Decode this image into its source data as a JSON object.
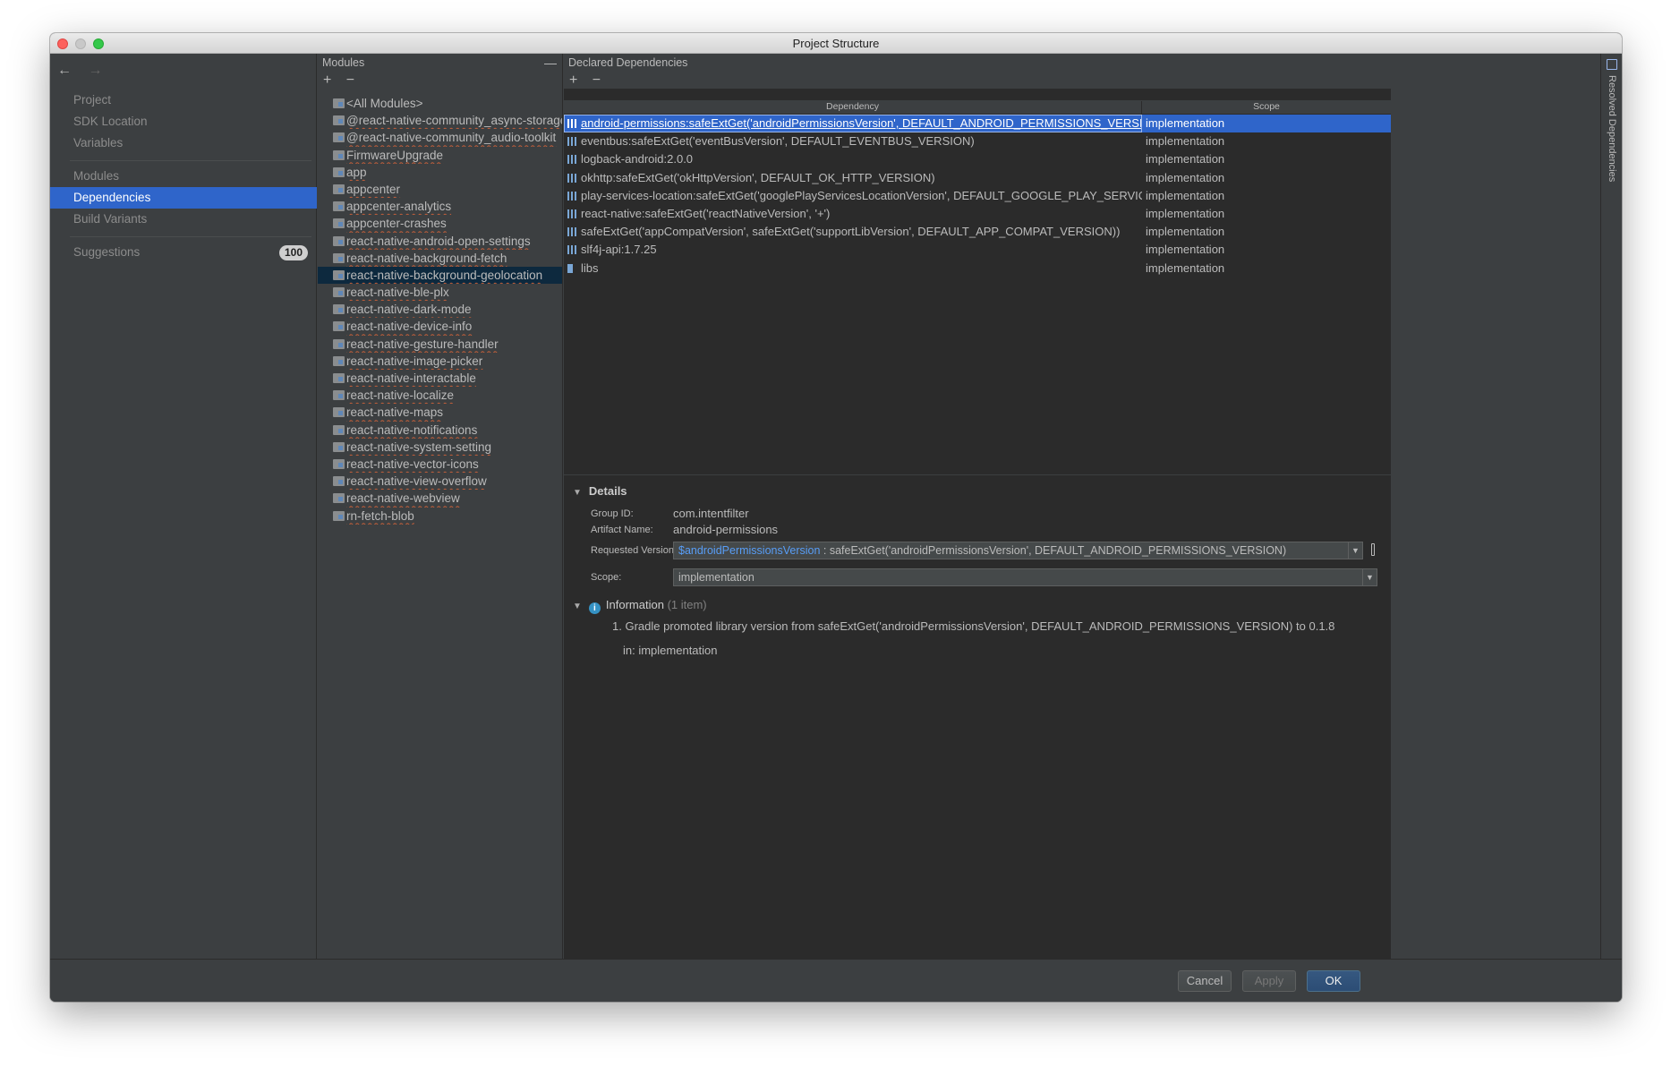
{
  "window": {
    "title": "Project Structure"
  },
  "nav": {
    "back_icon": "←",
    "forward_icon": "→",
    "items": [
      {
        "label": "Project"
      },
      {
        "label": "SDK Location"
      },
      {
        "label": "Variables"
      },
      {
        "label": "Modules"
      },
      {
        "label": "Dependencies",
        "selected": true
      },
      {
        "label": "Build Variants"
      },
      {
        "label": "Suggestions",
        "badge": "100"
      }
    ]
  },
  "modules": {
    "header": "Modules",
    "collapse_icon": "—",
    "add_icon": "+",
    "remove_icon": "−",
    "items": [
      "<All Modules>",
      "@react-native-community_async-storage",
      "@react-native-community_audio-toolkit",
      "FirmwareUpgrade",
      "app",
      "appcenter",
      "appcenter-analytics",
      "appcenter-crashes",
      "react-native-android-open-settings",
      "react-native-background-fetch",
      "react-native-background-geolocation",
      "react-native-ble-plx",
      "react-native-dark-mode",
      "react-native-device-info",
      "react-native-gesture-handler",
      "react-native-image-picker",
      "react-native-interactable",
      "react-native-localize",
      "react-native-maps",
      "react-native-notifications",
      "react-native-system-setting",
      "react-native-vector-icons",
      "react-native-view-overflow",
      "react-native-webview",
      "rn-fetch-blob"
    ],
    "selected_index": 10
  },
  "dependencies": {
    "header": "Declared Dependencies",
    "add_icon": "+",
    "remove_icon": "−",
    "columns": [
      "Dependency",
      "Scope"
    ],
    "rows": [
      {
        "name": "android-permissions:safeExtGet('androidPermissionsVersion', DEFAULT_ANDROID_PERMISSIONS_VERSION)",
        "scope": "implementation",
        "selected": true
      },
      {
        "name": "eventbus:safeExtGet('eventBusVersion', DEFAULT_EVENTBUS_VERSION)",
        "scope": "implementation"
      },
      {
        "name": "logback-android:2.0.0",
        "scope": "implementation"
      },
      {
        "name": "okhttp:safeExtGet('okHttpVersion', DEFAULT_OK_HTTP_VERSION)",
        "scope": "implementation"
      },
      {
        "name": "play-services-location:safeExtGet('googlePlayServicesLocationVersion', DEFAULT_GOOGLE_PLAY_SERVICES_LOCATION_",
        "scope": "implementation"
      },
      {
        "name": "react-native:safeExtGet('reactNativeVersion', '+')",
        "scope": "implementation"
      },
      {
        "name": "safeExtGet('appCompatVersion', safeExtGet('supportLibVersion', DEFAULT_APP_COMPAT_VERSION))",
        "scope": "implementation"
      },
      {
        "name": "slf4j-api:1.7.25",
        "scope": "implementation"
      },
      {
        "name": "libs",
        "scope": "implementation",
        "icon": "library-icon"
      }
    ]
  },
  "details": {
    "title": "Details",
    "group_id_label": "Group ID:",
    "group_id": "com.intentfilter",
    "artifact_label": "Artifact Name:",
    "artifact": "android-permissions",
    "version_label": "Requested Version:",
    "version_var": "$androidPermissionsVersion",
    "version_expr": " : safeExtGet('androidPermissionsVersion', DEFAULT_ANDROID_PERMISSIONS_VERSION)",
    "scope_label": "Scope:",
    "scope": "implementation"
  },
  "information": {
    "title": "Information",
    "count": "(1 item)",
    "message": "1. Gradle promoted library version from safeExtGet('androidPermissionsVersion', DEFAULT_ANDROID_PERMISSIONS_VERSION) to 0.1.8",
    "context": "in: implementation"
  },
  "right_strip": {
    "label": "Resolved Dependencies"
  },
  "footer": {
    "cancel": "Cancel",
    "apply": "Apply",
    "ok": "OK"
  },
  "colors": {
    "selection": "#2f65ca",
    "background": "#3c3f41",
    "table_bg": "#2b2b2b",
    "link_var": "#589df6"
  }
}
